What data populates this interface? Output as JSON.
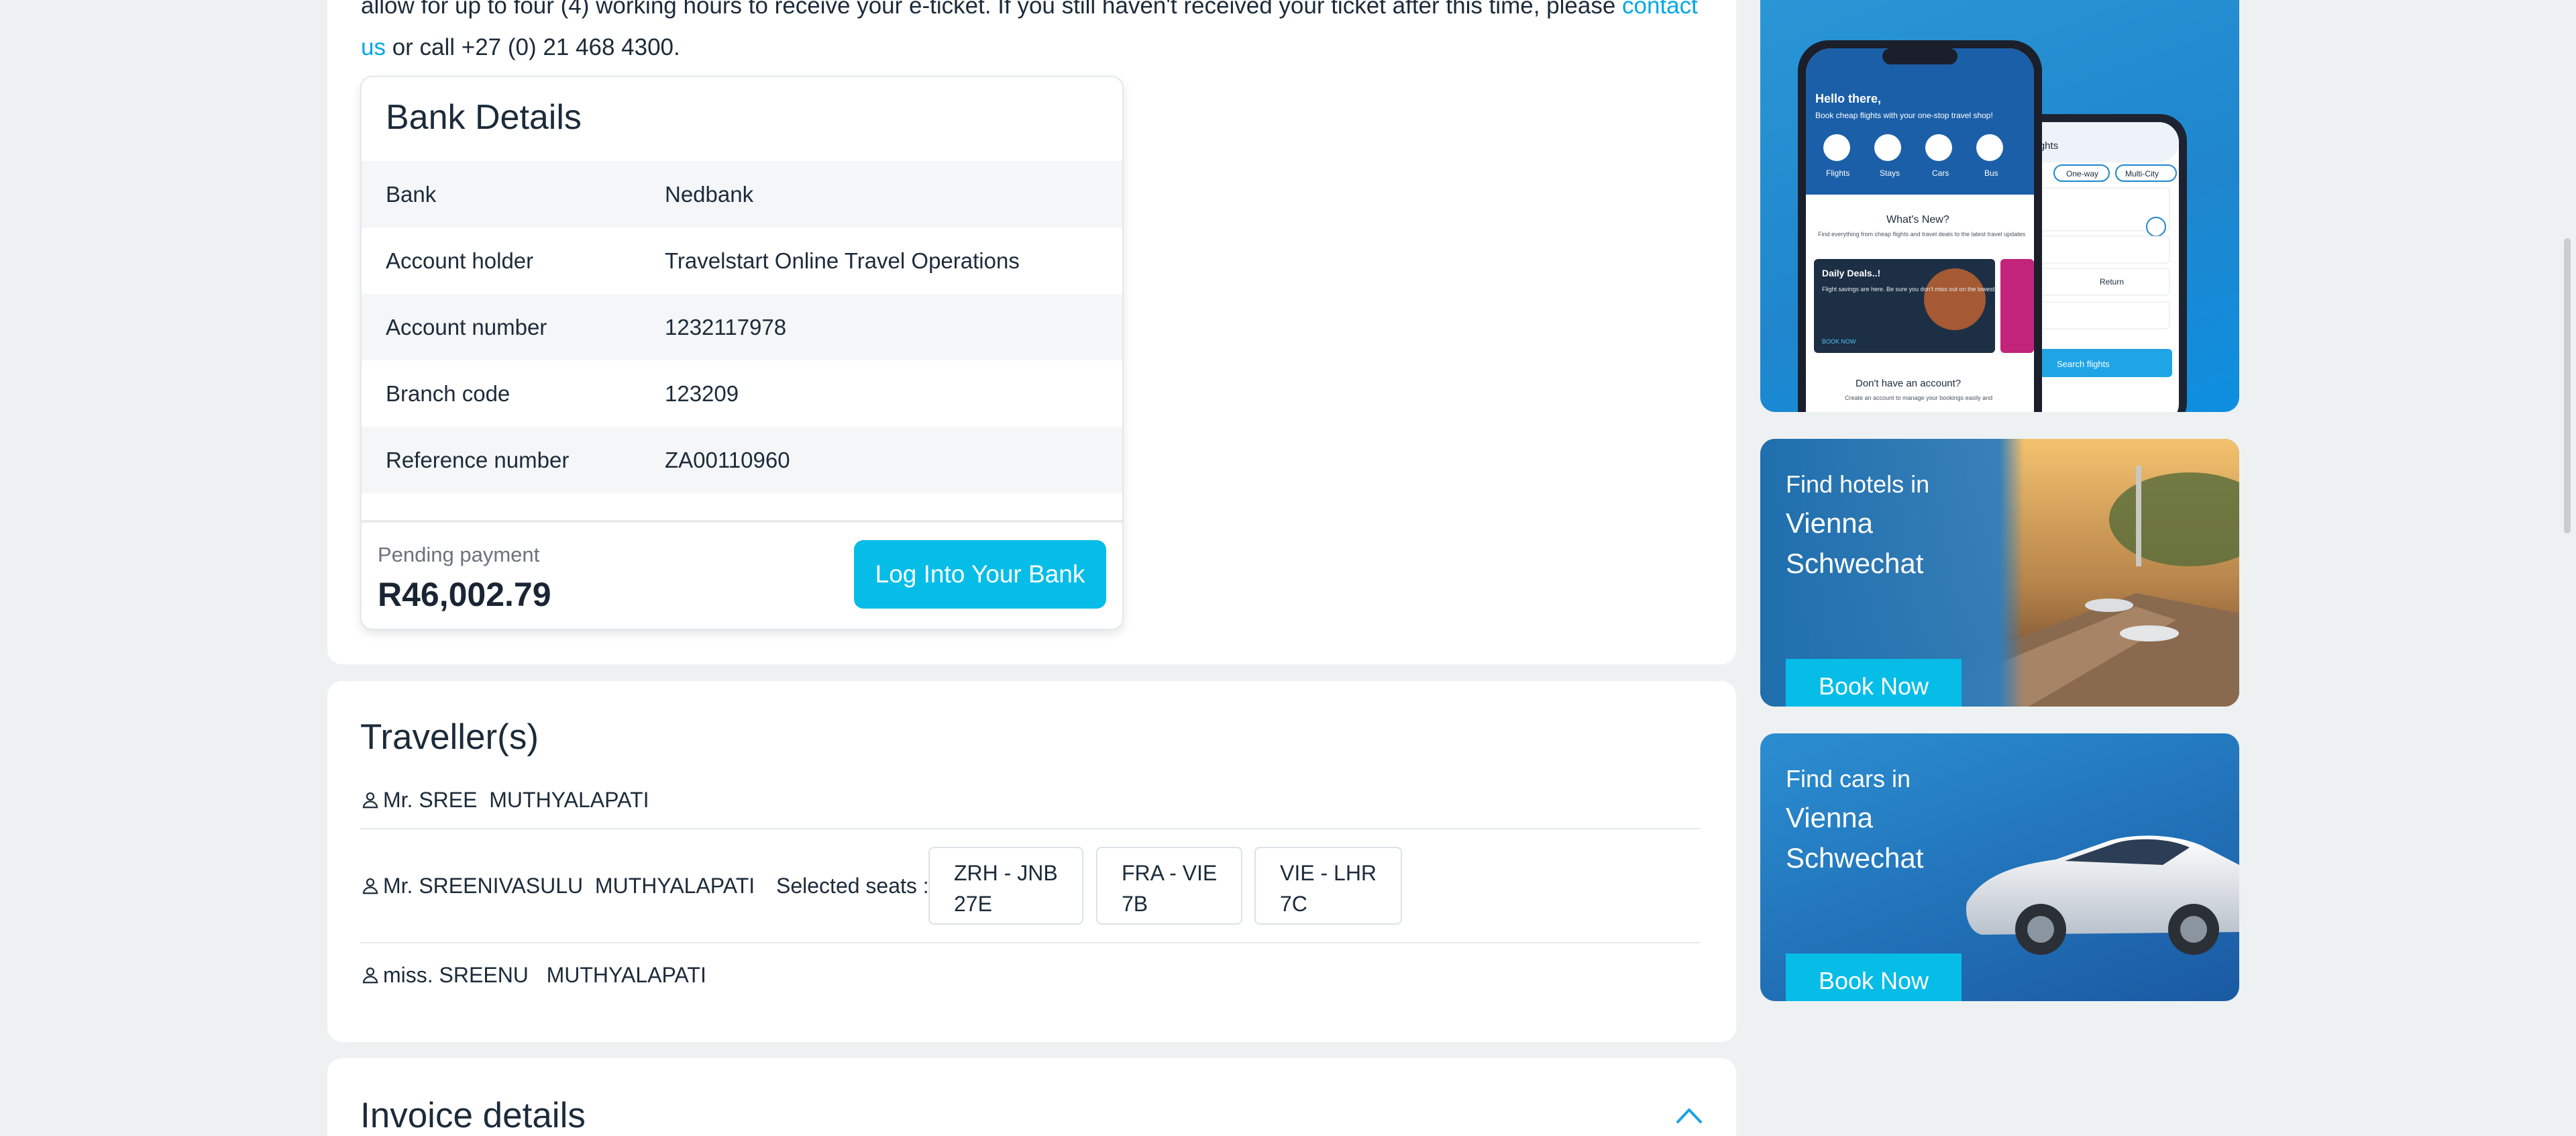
{
  "intro": {
    "line1": "allow for up to four (4) working hours to receive your e-ticket. If you still haven't received your ticket after this time, please ",
    "link_part1": "contact",
    "link_part2": "us",
    "line2": " or call +27 (0) 21 468 4300."
  },
  "bank_details": {
    "title": "Bank Details",
    "rows": [
      {
        "label": "Bank",
        "value": "Nedbank"
      },
      {
        "label": "Account holder",
        "value": "Travelstart Online Travel Operations"
      },
      {
        "label": "Account number",
        "value": "1232117978"
      },
      {
        "label": "Branch code",
        "value": "123209"
      },
      {
        "label": "Reference number",
        "value": "ZA00110960"
      }
    ],
    "pending_label": "Pending payment",
    "pending_amount": "R46,002.79",
    "login_button": "Log Into Your Bank"
  },
  "travellers": {
    "title": "Traveller(s)",
    "list": [
      {
        "name": "Mr. SREE  MUTHYALAPATI"
      },
      {
        "name": "Mr. SREENIVASULU  MUTHYALAPATI"
      },
      {
        "name": "miss. SREENU   MUTHYALAPATI"
      }
    ],
    "seats_label": "Selected seats :",
    "seats": [
      {
        "route": "ZRH - JNB",
        "seat": "27E"
      },
      {
        "route": "FRA - VIE",
        "seat": "7B"
      },
      {
        "route": "VIE - LHR",
        "seat": "7C"
      }
    ]
  },
  "invoice": {
    "title": "Invoice details",
    "toggle_icon": "chevron-up-icon"
  },
  "sidebar": {
    "app_ad": {
      "greeting": "Hello there,",
      "subtitle": "Book cheap flights with your one-stop travel shop!",
      "nav": [
        "Flights",
        "Stays",
        "Cars",
        "Bus"
      ],
      "whats_new": "What's New?",
      "whats_new_sub": "Find everything from cheap flights and travel deals to the latest travel updates",
      "deal_title": "Daily Deals..!",
      "deal_text": "Flight savings are here. Be sure you don't miss out on the lowest fares.",
      "deal_cta": "BOOK NOW",
      "no_account": "Don't have an account?",
      "no_account_sub": "Create an account to manage your bookings easily and",
      "search_title": "ch Flights",
      "trip_types": [
        "One-way",
        "Multi-City"
      ],
      "return_label": "Return",
      "search_btn": "Search flights"
    },
    "hotels_ad": {
      "line1": "Find hotels in",
      "line2": "Vienna",
      "line3": "Schwechat",
      "button": "Book Now"
    },
    "cars_ad": {
      "line1": "Find cars in",
      "line2": "Vienna",
      "line3": "Schwechat",
      "button": "Book Now"
    }
  },
  "colors": {
    "accent": "#06bde8",
    "link": "#00a8e6",
    "text": "#1c2b3a",
    "background": "#eef1f2"
  }
}
